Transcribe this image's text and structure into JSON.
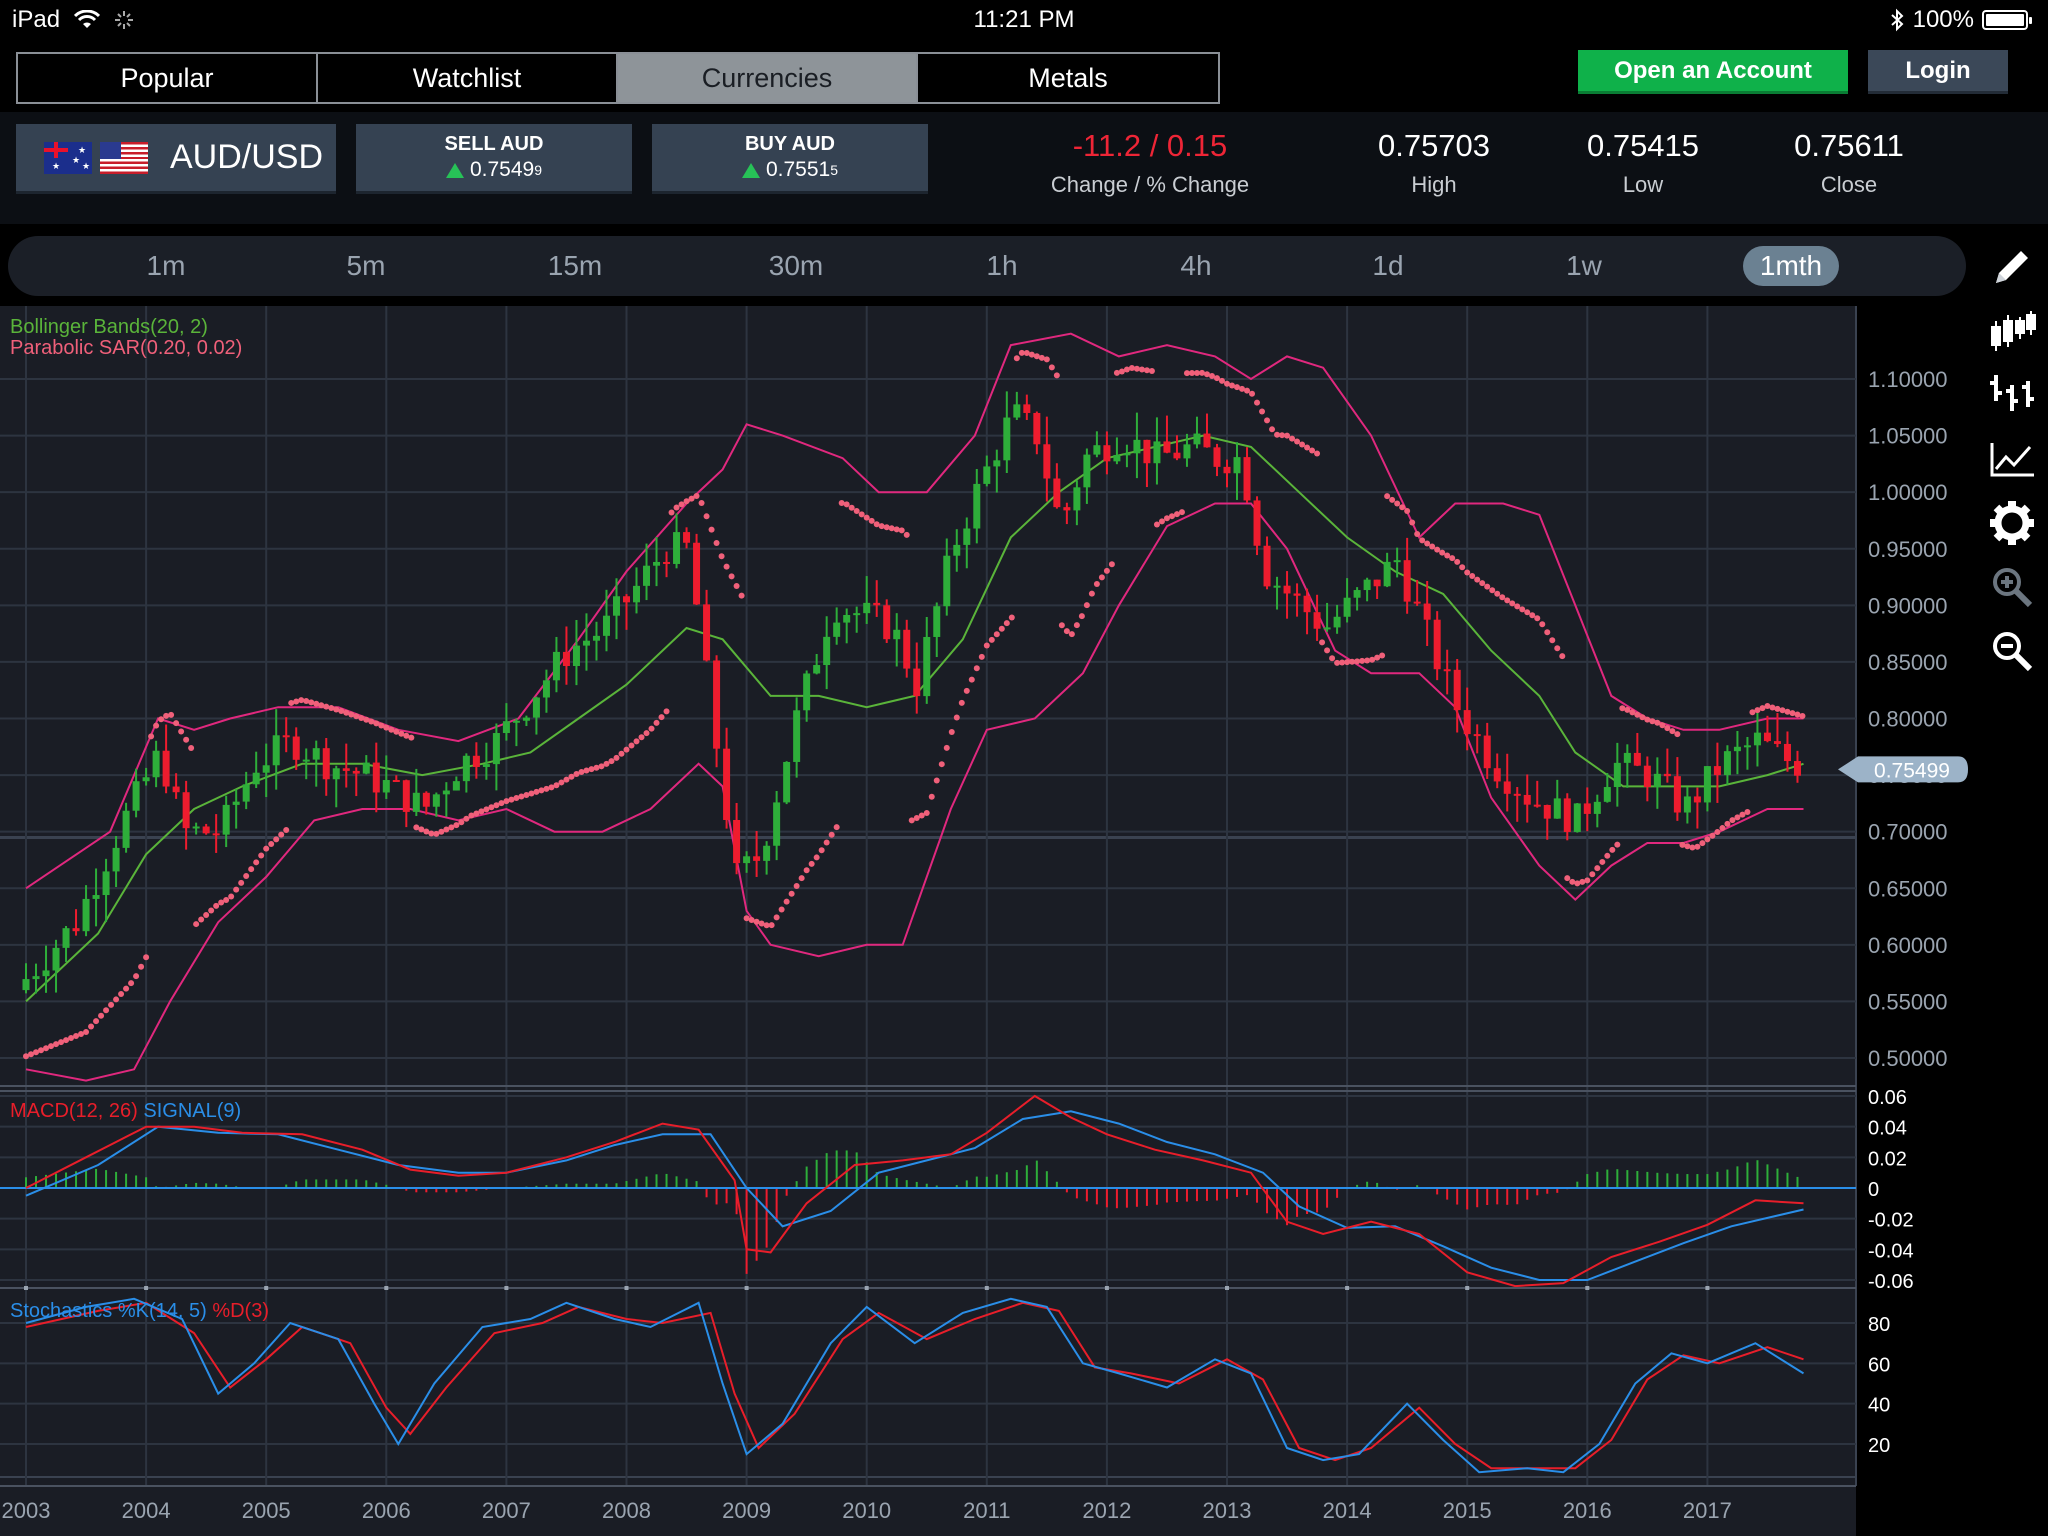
{
  "status": {
    "device": "iPad",
    "time": "11:21 PM",
    "battery": "100%"
  },
  "nav": {
    "tabs": [
      {
        "label": "Popular",
        "active": false
      },
      {
        "label": "Watchlist",
        "active": false
      },
      {
        "label": "Currencies",
        "active": true
      },
      {
        "label": "Metals",
        "active": false
      }
    ],
    "open_account": "Open an Account",
    "login": "Login"
  },
  "instrument": {
    "pair": "AUD/USD",
    "sell": {
      "label": "SELL AUD",
      "price": "0.7549",
      "pip": "9"
    },
    "buy": {
      "label": "BUY AUD",
      "price": "0.7551",
      "pip": "5"
    },
    "change": "-11.2 / 0.15",
    "change_label": "Change / % Change",
    "high": "0.75703",
    "high_label": "High",
    "low": "0.75415",
    "low_label": "Low",
    "close": "0.75611",
    "close_label": "Close"
  },
  "timeframes": [
    {
      "label": "1m",
      "active": false
    },
    {
      "label": "5m",
      "active": false
    },
    {
      "label": "15m",
      "active": false
    },
    {
      "label": "30m",
      "active": false
    },
    {
      "label": "1h",
      "active": false
    },
    {
      "label": "4h",
      "active": false
    },
    {
      "label": "1d",
      "active": false
    },
    {
      "label": "1w",
      "active": false
    },
    {
      "label": "1mth",
      "active": true
    }
  ],
  "tools": [
    "pencil-icon",
    "candlestick-icon",
    "ohlc-bars-icon",
    "line-chart-icon",
    "gear-icon",
    "zoom-in-icon",
    "zoom-out-icon"
  ],
  "colors": {
    "up": "#2eae3a",
    "down": "#ee1c2e",
    "bollinger_bands": "#e0287e",
    "bollinger_mid": "#5ab43a",
    "sar": "#f0607a",
    "macd": "#e81e2a",
    "signal": "#2a8ee8",
    "stoch_k": "#2a8ee8",
    "stoch_d": "#e81e2a",
    "price_badge": "#9cb3c8"
  },
  "chart_data": {
    "type": "candlestick",
    "indicators": {
      "bollinger": "Bollinger Bands(20, 2)",
      "sar": "Parabolic SAR(0.20, 0.02)",
      "macd": "MACD(12, 26)",
      "signal": "SIGNAL(9)",
      "stoch_k": "Stochastics %K(14, 5)",
      "stoch_d": "%D(3)"
    },
    "x_labels": [
      "2003",
      "2004",
      "2005",
      "2006",
      "2007",
      "2008",
      "2009",
      "2010",
      "2011",
      "2012",
      "2013",
      "2014",
      "2015",
      "2016",
      "2017"
    ],
    "price_axis": {
      "ticks": [
        "1.10000",
        "1.05000",
        "1.00000",
        "0.95000",
        "0.90000",
        "0.85000",
        "0.80000",
        "0.75000",
        "0.70000",
        "0.65000",
        "0.60000",
        "0.55000",
        "0.50000"
      ],
      "min": 0.48,
      "max": 1.13,
      "current": "0.75499"
    },
    "macd_axis": {
      "ticks": [
        "0.06",
        "0.04",
        "0.02",
        "0",
        "-0.02",
        "-0.04",
        "-0.06"
      ],
      "min": -0.066,
      "max": 0.066
    },
    "stoch_axis": {
      "ticks": [
        "80",
        "60",
        "40",
        "20"
      ],
      "min": 2,
      "max": 100
    },
    "price_path": [
      [
        2003.0,
        0.56
      ],
      [
        2003.5,
        0.62
      ],
      [
        2003.9,
        0.71
      ],
      [
        2004.2,
        0.77
      ],
      [
        2004.4,
        0.7
      ],
      [
        2004.7,
        0.7
      ],
      [
        2005.0,
        0.76
      ],
      [
        2005.3,
        0.78
      ],
      [
        2005.6,
        0.76
      ],
      [
        2005.9,
        0.75
      ],
      [
        2006.1,
        0.74
      ],
      [
        2006.4,
        0.72
      ],
      [
        2006.7,
        0.76
      ],
      [
        2007.0,
        0.78
      ],
      [
        2007.3,
        0.82
      ],
      [
        2007.6,
        0.86
      ],
      [
        2007.9,
        0.88
      ],
      [
        2008.2,
        0.92
      ],
      [
        2008.4,
        0.95
      ],
      [
        2008.6,
        0.95
      ],
      [
        2008.8,
        0.8
      ],
      [
        2009.0,
        0.66
      ],
      [
        2009.2,
        0.68
      ],
      [
        2009.5,
        0.8
      ],
      [
        2009.8,
        0.9
      ],
      [
        2010.1,
        0.89
      ],
      [
        2010.3,
        0.88
      ],
      [
        2010.5,
        0.83
      ],
      [
        2010.8,
        0.95
      ],
      [
        2011.0,
        1.0
      ],
      [
        2011.3,
        1.07
      ],
      [
        2011.5,
        1.05
      ],
      [
        2011.7,
        0.97
      ],
      [
        2011.9,
        1.03
      ],
      [
        2012.2,
        1.05
      ],
      [
        2012.5,
        1.03
      ],
      [
        2012.8,
        1.04
      ],
      [
        2013.0,
        1.03
      ],
      [
        2013.2,
        1.03
      ],
      [
        2013.4,
        0.93
      ],
      [
        2013.7,
        0.9
      ],
      [
        2013.9,
        0.88
      ],
      [
        2014.2,
        0.91
      ],
      [
        2014.5,
        0.94
      ],
      [
        2014.8,
        0.86
      ],
      [
        2015.0,
        0.81
      ],
      [
        2015.3,
        0.76
      ],
      [
        2015.6,
        0.73
      ],
      [
        2015.8,
        0.72
      ],
      [
        2016.0,
        0.71
      ],
      [
        2016.3,
        0.76
      ],
      [
        2016.6,
        0.75
      ],
      [
        2016.9,
        0.72
      ],
      [
        2017.2,
        0.76
      ],
      [
        2017.5,
        0.78
      ],
      [
        2017.8,
        0.76
      ]
    ],
    "bb_upper": [
      [
        2003.0,
        0.65
      ],
      [
        2003.7,
        0.7
      ],
      [
        2004.1,
        0.8
      ],
      [
        2004.4,
        0.79
      ],
      [
        2004.7,
        0.8
      ],
      [
        2005.1,
        0.81
      ],
      [
        2005.6,
        0.81
      ],
      [
        2006.1,
        0.79
      ],
      [
        2006.6,
        0.78
      ],
      [
        2007.1,
        0.8
      ],
      [
        2007.6,
        0.87
      ],
      [
        2008.0,
        0.93
      ],
      [
        2008.5,
        0.99
      ],
      [
        2008.8,
        1.02
      ],
      [
        2009.0,
        1.06
      ],
      [
        2009.3,
        1.05
      ],
      [
        2009.8,
        1.03
      ],
      [
        2010.1,
        1.0
      ],
      [
        2010.5,
        1.0
      ],
      [
        2010.9,
        1.05
      ],
      [
        2011.2,
        1.13
      ],
      [
        2011.7,
        1.14
      ],
      [
        2012.1,
        1.12
      ],
      [
        2012.5,
        1.13
      ],
      [
        2012.9,
        1.12
      ],
      [
        2013.2,
        1.1
      ],
      [
        2013.5,
        1.12
      ],
      [
        2013.8,
        1.11
      ],
      [
        2014.2,
        1.05
      ],
      [
        2014.6,
        0.96
      ],
      [
        2014.9,
        0.99
      ],
      [
        2015.3,
        0.99
      ],
      [
        2015.6,
        0.98
      ],
      [
        2015.9,
        0.9
      ],
      [
        2016.2,
        0.82
      ],
      [
        2016.5,
        0.8
      ],
      [
        2016.8,
        0.79
      ],
      [
        2017.1,
        0.79
      ],
      [
        2017.5,
        0.8
      ],
      [
        2017.8,
        0.8
      ]
    ],
    "bb_lower": [
      [
        2003.0,
        0.49
      ],
      [
        2003.5,
        0.48
      ],
      [
        2003.9,
        0.49
      ],
      [
        2004.2,
        0.55
      ],
      [
        2004.6,
        0.62
      ],
      [
        2005.0,
        0.66
      ],
      [
        2005.4,
        0.71
      ],
      [
        2005.8,
        0.72
      ],
      [
        2006.2,
        0.72
      ],
      [
        2006.6,
        0.71
      ],
      [
        2007.0,
        0.72
      ],
      [
        2007.4,
        0.7
      ],
      [
        2007.8,
        0.7
      ],
      [
        2008.2,
        0.72
      ],
      [
        2008.6,
        0.76
      ],
      [
        2008.8,
        0.74
      ],
      [
        2009.0,
        0.63
      ],
      [
        2009.2,
        0.6
      ],
      [
        2009.6,
        0.59
      ],
      [
        2010.0,
        0.6
      ],
      [
        2010.3,
        0.6
      ],
      [
        2010.7,
        0.72
      ],
      [
        2011.0,
        0.79
      ],
      [
        2011.4,
        0.8
      ],
      [
        2011.8,
        0.84
      ],
      [
        2012.1,
        0.9
      ],
      [
        2012.5,
        0.97
      ],
      [
        2012.9,
        0.99
      ],
      [
        2013.2,
        0.99
      ],
      [
        2013.5,
        0.95
      ],
      [
        2013.9,
        0.86
      ],
      [
        2014.2,
        0.84
      ],
      [
        2014.6,
        0.84
      ],
      [
        2014.9,
        0.81
      ],
      [
        2015.2,
        0.73
      ],
      [
        2015.6,
        0.67
      ],
      [
        2015.9,
        0.64
      ],
      [
        2016.2,
        0.67
      ],
      [
        2016.5,
        0.69
      ],
      [
        2016.8,
        0.69
      ],
      [
        2017.1,
        0.7
      ],
      [
        2017.5,
        0.72
      ],
      [
        2017.8,
        0.72
      ]
    ],
    "bb_middle": [
      [
        2003.0,
        0.55
      ],
      [
        2003.6,
        0.61
      ],
      [
        2004.0,
        0.68
      ],
      [
        2004.4,
        0.72
      ],
      [
        2004.8,
        0.74
      ],
      [
        2005.3,
        0.76
      ],
      [
        2005.8,
        0.76
      ],
      [
        2006.3,
        0.75
      ],
      [
        2006.8,
        0.76
      ],
      [
        2007.2,
        0.77
      ],
      [
        2007.6,
        0.8
      ],
      [
        2008.0,
        0.83
      ],
      [
        2008.5,
        0.88
      ],
      [
        2008.8,
        0.87
      ],
      [
        2009.2,
        0.82
      ],
      [
        2009.6,
        0.82
      ],
      [
        2010.0,
        0.81
      ],
      [
        2010.4,
        0.82
      ],
      [
        2010.8,
        0.87
      ],
      [
        2011.2,
        0.96
      ],
      [
        2011.6,
        1.0
      ],
      [
        2012.0,
        1.03
      ],
      [
        2012.4,
        1.04
      ],
      [
        2012.8,
        1.05
      ],
      [
        2013.2,
        1.04
      ],
      [
        2013.6,
        1.0
      ],
      [
        2014.0,
        0.96
      ],
      [
        2014.4,
        0.93
      ],
      [
        2014.8,
        0.91
      ],
      [
        2015.2,
        0.86
      ],
      [
        2015.6,
        0.82
      ],
      [
        2015.9,
        0.77
      ],
      [
        2016.3,
        0.74
      ],
      [
        2016.7,
        0.74
      ],
      [
        2017.1,
        0.74
      ],
      [
        2017.5,
        0.75
      ],
      [
        2017.8,
        0.76
      ]
    ],
    "macd_line": [
      [
        2003.0,
        0.0
      ],
      [
        2003.5,
        0.02
      ],
      [
        2004.0,
        0.04
      ],
      [
        2004.4,
        0.04
      ],
      [
        2004.8,
        0.036
      ],
      [
        2005.3,
        0.035
      ],
      [
        2005.8,
        0.025
      ],
      [
        2006.2,
        0.012
      ],
      [
        2006.6,
        0.008
      ],
      [
        2007.0,
        0.01
      ],
      [
        2007.5,
        0.02
      ],
      [
        2007.9,
        0.03
      ],
      [
        2008.3,
        0.042
      ],
      [
        2008.6,
        0.038
      ],
      [
        2008.9,
        0.005
      ],
      [
        2009.0,
        -0.04
      ],
      [
        2009.2,
        -0.042
      ],
      [
        2009.5,
        -0.01
      ],
      [
        2009.9,
        0.015
      ],
      [
        2010.3,
        0.018
      ],
      [
        2010.7,
        0.022
      ],
      [
        2011.0,
        0.036
      ],
      [
        2011.4,
        0.06
      ],
      [
        2011.7,
        0.046
      ],
      [
        2012.0,
        0.035
      ],
      [
        2012.4,
        0.025
      ],
      [
        2012.8,
        0.018
      ],
      [
        2013.2,
        0.01
      ],
      [
        2013.5,
        -0.022
      ],
      [
        2013.8,
        -0.03
      ],
      [
        2014.2,
        -0.022
      ],
      [
        2014.6,
        -0.03
      ],
      [
        2015.0,
        -0.055
      ],
      [
        2015.4,
        -0.064
      ],
      [
        2015.8,
        -0.062
      ],
      [
        2016.2,
        -0.045
      ],
      [
        2016.6,
        -0.035
      ],
      [
        2017.0,
        -0.024
      ],
      [
        2017.4,
        -0.008
      ],
      [
        2017.8,
        -0.01
      ]
    ],
    "signal_line": [
      [
        2003.0,
        -0.005
      ],
      [
        2003.6,
        0.015
      ],
      [
        2004.1,
        0.04
      ],
      [
        2004.6,
        0.036
      ],
      [
        2005.1,
        0.035
      ],
      [
        2005.6,
        0.025
      ],
      [
        2006.1,
        0.015
      ],
      [
        2006.6,
        0.01
      ],
      [
        2007.0,
        0.01
      ],
      [
        2007.5,
        0.018
      ],
      [
        2007.9,
        0.028
      ],
      [
        2008.3,
        0.035
      ],
      [
        2008.7,
        0.035
      ],
      [
        2009.0,
        0.0
      ],
      [
        2009.3,
        -0.025
      ],
      [
        2009.7,
        -0.015
      ],
      [
        2010.1,
        0.01
      ],
      [
        2010.5,
        0.018
      ],
      [
        2010.9,
        0.026
      ],
      [
        2011.3,
        0.045
      ],
      [
        2011.7,
        0.05
      ],
      [
        2012.1,
        0.042
      ],
      [
        2012.5,
        0.03
      ],
      [
        2012.9,
        0.022
      ],
      [
        2013.3,
        0.01
      ],
      [
        2013.6,
        -0.012
      ],
      [
        2014.0,
        -0.026
      ],
      [
        2014.4,
        -0.025
      ],
      [
        2014.8,
        -0.038
      ],
      [
        2015.2,
        -0.052
      ],
      [
        2015.6,
        -0.06
      ],
      [
        2016.0,
        -0.06
      ],
      [
        2016.4,
        -0.048
      ],
      [
        2016.8,
        -0.036
      ],
      [
        2017.2,
        -0.025
      ],
      [
        2017.8,
        -0.014
      ]
    ],
    "stoch_k": [
      [
        2003.0,
        80
      ],
      [
        2003.5,
        88
      ],
      [
        2003.9,
        92
      ],
      [
        2004.3,
        82
      ],
      [
        2004.6,
        45
      ],
      [
        2004.9,
        60
      ],
      [
        2005.2,
        80
      ],
      [
        2005.6,
        72
      ],
      [
        2005.9,
        40
      ],
      [
        2006.1,
        20
      ],
      [
        2006.4,
        50
      ],
      [
        2006.8,
        78
      ],
      [
        2007.2,
        82
      ],
      [
        2007.5,
        90
      ],
      [
        2007.9,
        82
      ],
      [
        2008.2,
        78
      ],
      [
        2008.6,
        90
      ],
      [
        2008.8,
        50
      ],
      [
        2009.0,
        15
      ],
      [
        2009.3,
        30
      ],
      [
        2009.7,
        70
      ],
      [
        2010.0,
        88
      ],
      [
        2010.4,
        70
      ],
      [
        2010.8,
        85
      ],
      [
        2011.2,
        92
      ],
      [
        2011.5,
        88
      ],
      [
        2011.8,
        60
      ],
      [
        2012.1,
        55
      ],
      [
        2012.5,
        48
      ],
      [
        2012.9,
        62
      ],
      [
        2013.2,
        55
      ],
      [
        2013.5,
        18
      ],
      [
        2013.8,
        12
      ],
      [
        2014.1,
        15
      ],
      [
        2014.5,
        40
      ],
      [
        2014.8,
        22
      ],
      [
        2015.1,
        6
      ],
      [
        2015.5,
        8
      ],
      [
        2015.8,
        6
      ],
      [
        2016.1,
        20
      ],
      [
        2016.4,
        50
      ],
      [
        2016.7,
        65
      ],
      [
        2017.0,
        60
      ],
      [
        2017.4,
        70
      ],
      [
        2017.8,
        55
      ]
    ],
    "stoch_d": [
      [
        2003.0,
        78
      ],
      [
        2003.6,
        86
      ],
      [
        2004.0,
        90
      ],
      [
        2004.4,
        75
      ],
      [
        2004.7,
        48
      ],
      [
        2005.0,
        62
      ],
      [
        2005.3,
        78
      ],
      [
        2005.7,
        70
      ],
      [
        2006.0,
        38
      ],
      [
        2006.2,
        25
      ],
      [
        2006.5,
        48
      ],
      [
        2006.9,
        75
      ],
      [
        2007.3,
        80
      ],
      [
        2007.6,
        88
      ],
      [
        2008.0,
        82
      ],
      [
        2008.3,
        80
      ],
      [
        2008.7,
        85
      ],
      [
        2008.9,
        45
      ],
      [
        2009.1,
        18
      ],
      [
        2009.4,
        35
      ],
      [
        2009.8,
        72
      ],
      [
        2010.1,
        85
      ],
      [
        2010.5,
        72
      ],
      [
        2010.9,
        82
      ],
      [
        2011.3,
        90
      ],
      [
        2011.6,
        86
      ],
      [
        2011.9,
        58
      ],
      [
        2012.2,
        55
      ],
      [
        2012.6,
        50
      ],
      [
        2013.0,
        62
      ],
      [
        2013.3,
        52
      ],
      [
        2013.6,
        18
      ],
      [
        2013.9,
        12
      ],
      [
        2014.2,
        18
      ],
      [
        2014.6,
        38
      ],
      [
        2014.9,
        20
      ],
      [
        2015.2,
        8
      ],
      [
        2015.6,
        8
      ],
      [
        2015.9,
        8
      ],
      [
        2016.2,
        22
      ],
      [
        2016.5,
        52
      ],
      [
        2016.8,
        64
      ],
      [
        2017.1,
        60
      ],
      [
        2017.5,
        68
      ],
      [
        2017.8,
        62
      ]
    ]
  }
}
